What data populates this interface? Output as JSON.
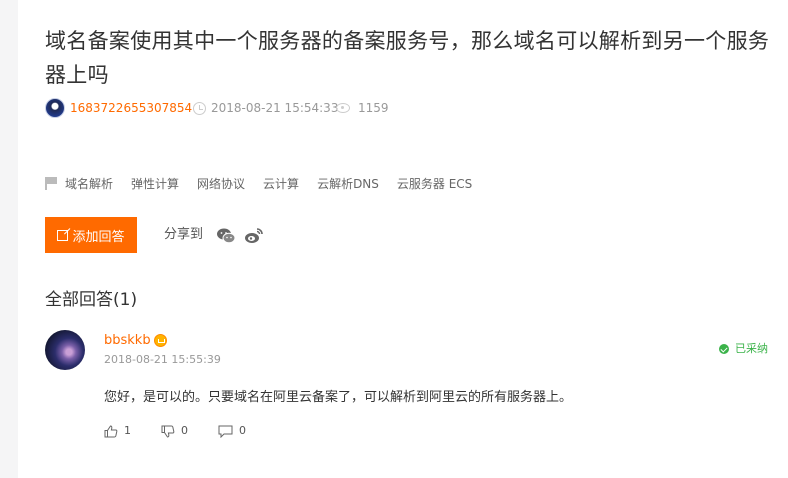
{
  "question": {
    "title": "域名备案使用其中一个服务器的备案服务号，那么域名可以解析到另一个服务器上吗",
    "asker": "1683722655307854",
    "time": "2018-08-21 15:54:33",
    "views": "1159"
  },
  "tags": [
    "域名解析",
    "弹性计算",
    "网络协议",
    "云计算",
    "云解析DNS",
    "云服务器 ECS"
  ],
  "actions": {
    "add_answer": "添加回答",
    "share_label": "分享到"
  },
  "answers_header": "全部回答(1)",
  "answer": {
    "user": "bbskkb",
    "time": "2018-08-21 15:55:39",
    "status": "已采纳",
    "content": "您好，是可以的。只要域名在阿里云备案了，可以解析到阿里云的所有服务器上。",
    "likes": "1",
    "dislikes": "0",
    "comments": "0"
  },
  "colors": {
    "accent": "#ff6a00",
    "adopted": "#3bb34a"
  },
  "icons": [
    "clock-icon",
    "eye-icon",
    "tag-flag-icon",
    "edit-icon",
    "wechat-icon",
    "weibo-icon",
    "verified-badge-icon",
    "check-icon",
    "thumb-up-icon",
    "thumb-down-icon",
    "comment-icon"
  ]
}
